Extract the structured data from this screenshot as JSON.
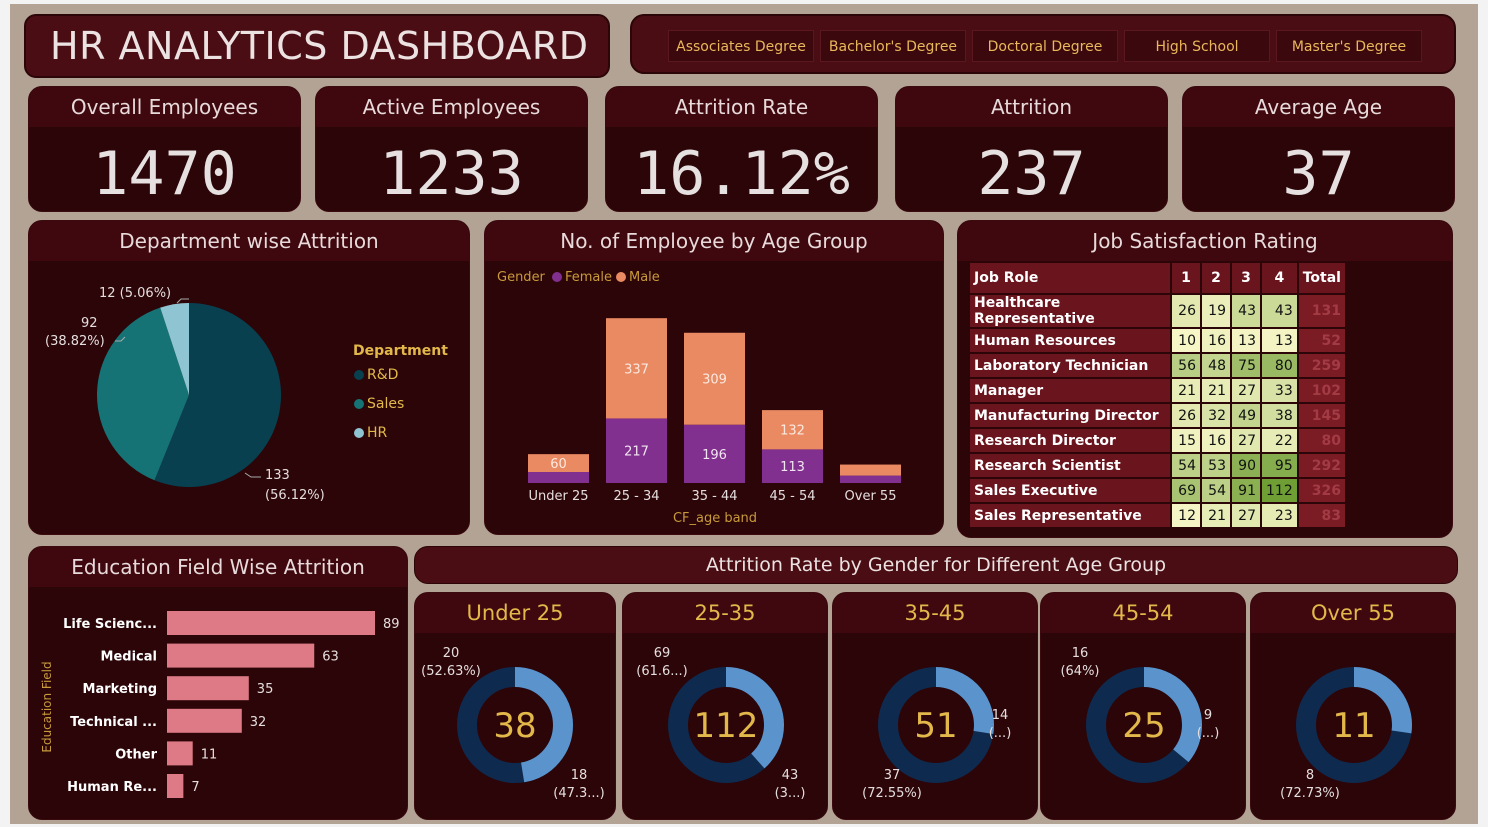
{
  "title": "HR ANALYTICS DASHBOARD",
  "slicer": [
    "Associates Degree",
    "Bachelor's Degree",
    "Doctoral Degree",
    "High School",
    "Master's Degree"
  ],
  "kpis": [
    {
      "label": "Overall Employees",
      "value": "1470"
    },
    {
      "label": "Active Employees",
      "value": "1233"
    },
    {
      "label": "Attrition Rate",
      "value": "16.12%"
    },
    {
      "label": "Attrition",
      "value": "237"
    },
    {
      "label": "Average Age",
      "value": "37"
    }
  ],
  "department_chart": {
    "title": "Department wise Attrition",
    "legend_title": "Department",
    "labels": [
      "133",
      "(56.12%)",
      "92",
      "(38.82%)",
      "12 (5.06%)"
    ]
  },
  "age_chart": {
    "title": "No. of Employee by Age Group",
    "legend_title": "Gender",
    "legend_female": "Female",
    "legend_male": "Male",
    "xlabel": "CF_age band"
  },
  "job_satisfaction": {
    "title": "Job Satisfaction Rating",
    "headers": [
      "Job Role",
      "1",
      "2",
      "3",
      "4",
      "Total"
    ],
    "rows": [
      {
        "role": "Healthcare Representative",
        "vals": [
          "26",
          "19",
          "43",
          "43"
        ],
        "total": "131"
      },
      {
        "role": "Human Resources",
        "vals": [
          "10",
          "16",
          "13",
          "13"
        ],
        "total": "52"
      },
      {
        "role": "Laboratory Technician",
        "vals": [
          "56",
          "48",
          "75",
          "80"
        ],
        "total": "259"
      },
      {
        "role": "Manager",
        "vals": [
          "21",
          "21",
          "27",
          "33"
        ],
        "total": "102"
      },
      {
        "role": "Manufacturing Director",
        "vals": [
          "26",
          "32",
          "49",
          "38"
        ],
        "total": "145"
      },
      {
        "role": "Research Director",
        "vals": [
          "15",
          "16",
          "27",
          "22"
        ],
        "total": "80"
      },
      {
        "role": "Research Scientist",
        "vals": [
          "54",
          "53",
          "90",
          "95"
        ],
        "total": "292"
      },
      {
        "role": "Sales Executive",
        "vals": [
          "69",
          "54",
          "91",
          "112"
        ],
        "total": "326"
      },
      {
        "role": "Sales Representative",
        "vals": [
          "12",
          "21",
          "27",
          "23"
        ],
        "total": "83"
      }
    ]
  },
  "education_chart": {
    "title": "Education Field Wise Attrition",
    "ylabel": "Education Field"
  },
  "attrition_banner": "Attrition Rate by Gender for Different Age Group",
  "donuts": [
    {
      "title": "Under 25",
      "center": "38",
      "male_frac": 0.5263,
      "male_label": [
        "20",
        "(52.63%)"
      ],
      "female_label": [
        "18",
        "(47.3...)"
      ]
    },
    {
      "title": "25-35",
      "center": "112",
      "male_frac": 0.616,
      "male_label": [
        "69",
        "(61.6...)"
      ],
      "female_label": [
        "43",
        "(3...)"
      ]
    },
    {
      "title": "35-45",
      "center": "51",
      "male_frac": 0.7255,
      "male_label": [
        "37",
        "(72.55%)"
      ],
      "female_label": [
        "14",
        "(...)"
      ]
    },
    {
      "title": "45-54",
      "center": "25",
      "male_frac": 0.64,
      "male_label": [
        "16",
        "(64%)"
      ],
      "female_label": [
        "9",
        "(...)"
      ]
    },
    {
      "title": "Over 55",
      "center": "11",
      "male_frac": 0.7273,
      "male_label": [
        "8",
        "(72.73%)"
      ],
      "female_label": [],
      "female_frac": 0.2727
    }
  ],
  "colors": {
    "rd": "#08404f",
    "sales": "#157376",
    "hr": "#8fc4d3",
    "female": "#82308f",
    "male": "#ea8a62",
    "edu_bar": "#de7a86",
    "donut_dark": "#0f2a4f",
    "donut_light": "#5b94cc",
    "gold": "#e3b84a"
  },
  "chart_data": [
    {
      "type": "pie",
      "title": "Department wise Attrition",
      "categories": [
        "R&D",
        "Sales",
        "HR"
      ],
      "values": [
        133,
        92,
        12
      ],
      "percent": [
        56.12,
        38.82,
        5.06
      ]
    },
    {
      "type": "bar",
      "title": "No. of Employee by Age Group",
      "xlabel": "CF_age band",
      "categories": [
        "Under 25",
        "25 - 34",
        "35 - 44",
        "45 - 54",
        "Over 55"
      ],
      "series": [
        {
          "name": "Female",
          "values": [
            37,
            217,
            196,
            113,
            25
          ]
        },
        {
          "name": "Male",
          "values": [
            60,
            337,
            309,
            132,
            37
          ]
        }
      ],
      "ylim": [
        0,
        600
      ]
    },
    {
      "type": "bar",
      "title": "Education Field Wise Attrition",
      "ylabel": "Education Field",
      "categories": [
        "Life Scienc...",
        "Medical",
        "Marketing",
        "Technical ...",
        "Other",
        "Human Re..."
      ],
      "values": [
        89,
        63,
        35,
        32,
        11,
        7
      ],
      "orientation": "horizontal"
    }
  ]
}
